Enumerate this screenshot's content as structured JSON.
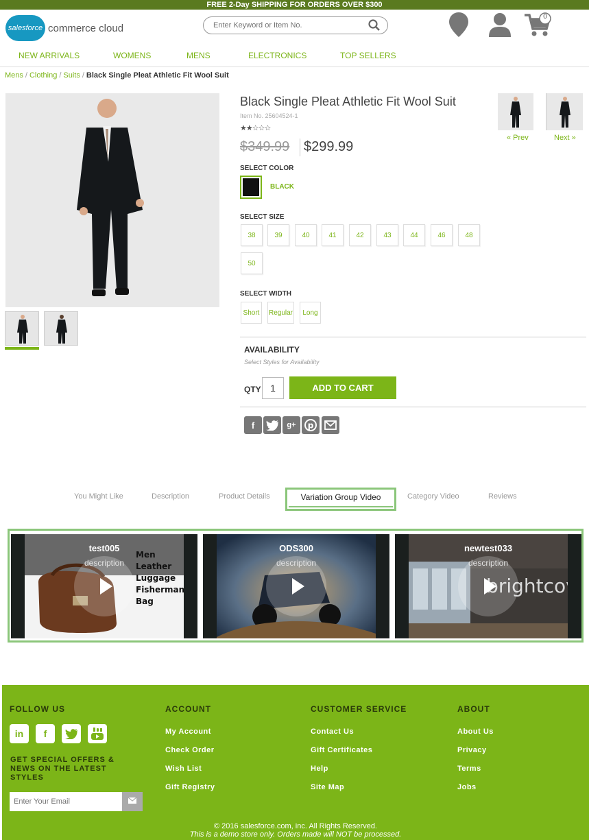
{
  "promo": {
    "text": "FREE 2-Day SHIPPING FOR ORDERS OVER $300"
  },
  "header": {
    "logo_badge": "salesforce",
    "logo_text": "commerce cloud",
    "search_placeholder": "Enter Keyword or Item No.",
    "cart_count": "0"
  },
  "nav": [
    "NEW ARRIVALS",
    "WOMENS",
    "MENS",
    "ELECTRONICS",
    "TOP SELLERS"
  ],
  "breadcrumb": {
    "items": [
      "Mens",
      "Clothing",
      "Suits"
    ],
    "current": "Black Single Pleat Athletic Fit Wool Suit"
  },
  "product": {
    "title": "Black Single Pleat Athletic Fit Wool Suit",
    "item_no": "Item No. 25604524-1",
    "rating_stars": "★★☆☆☆",
    "rating_value": 2.5,
    "old_price": "$349.99",
    "price": "$299.99",
    "prev": "« Prev",
    "next": "Next »",
    "select_color_label": "SELECT COLOR",
    "color_name": "BLACK",
    "select_size_label": "SELECT SIZE",
    "sizes": [
      "38",
      "39",
      "40",
      "41",
      "42",
      "43",
      "44",
      "46",
      "48",
      "50"
    ],
    "select_width_label": "SELECT WIDTH",
    "widths": [
      "Short",
      "Regular",
      "Long"
    ],
    "availability_title": "AVAILABILITY",
    "availability_sub": "Select Styles for Availability",
    "qty_label": "QTY",
    "qty_value": "1",
    "add_to_cart": "ADD TO CART",
    "share_icons": [
      "facebook-icon",
      "twitter-icon",
      "google-plus-icon",
      "pinterest-icon",
      "email-icon"
    ]
  },
  "tabs": {
    "items": [
      "You Might Like",
      "Description",
      "Product Details",
      "Variation Group Video",
      "Category Video",
      "Reviews"
    ],
    "active": "Variation Group Video"
  },
  "videos": [
    {
      "title": "test005",
      "description": "description",
      "overlay": "Men Leather Luggage Fisherman Bag"
    },
    {
      "title": "ODS300",
      "description": "description",
      "overlay": ""
    },
    {
      "title": "newtest033",
      "description": "description",
      "overlay": "brightcove"
    }
  ],
  "footer": {
    "follow_us": "FOLLOW US",
    "offer_text": "GET SPECIAL OFFERS & NEWS ON THE LATEST STYLES",
    "email_placeholder": "Enter Your Email",
    "account": {
      "heading": "ACCOUNT",
      "links": [
        "My Account",
        "Check Order",
        "Wish List",
        "Gift Registry"
      ]
    },
    "customer_service": {
      "heading": "CUSTOMER SERVICE",
      "links": [
        "Contact Us",
        "Gift Certificates",
        "Help",
        "Site Map"
      ]
    },
    "about": {
      "heading": "ABOUT",
      "links": [
        "About Us",
        "Privacy",
        "Terms",
        "Jobs"
      ]
    },
    "copyright": "© 2016 salesforce.com, inc. All Rights Reserved.",
    "demo_notice": "This is a demo store only. Orders made will NOT be processed."
  },
  "colors": {
    "brand_green": "#7cb518",
    "promo_bar": "#5a7a1f",
    "tab_border": "#8bc67a",
    "salesforce_blue": "#1798c1"
  }
}
